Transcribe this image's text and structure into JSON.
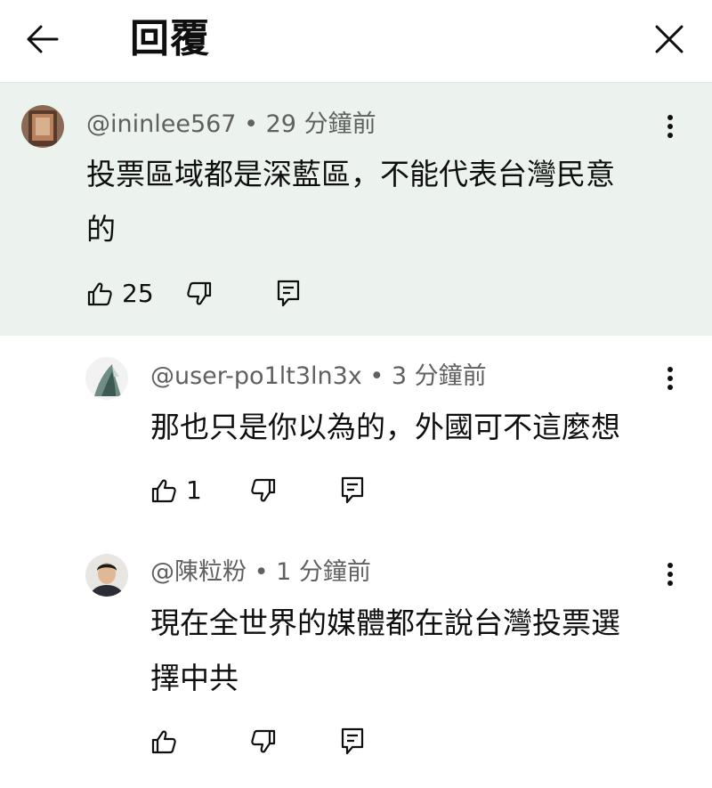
{
  "header": {
    "title": "回覆",
    "back_icon": "arrow-left-icon",
    "close_icon": "close-icon"
  },
  "comments": [
    {
      "author": "@ininlee567",
      "separator": "•",
      "time": "29 分鐘前",
      "text_line1": "投票區域都是深藍區，不能代表台灣民意",
      "text_line2": "的",
      "likes": "25",
      "highlighted": true
    },
    {
      "author": "@user-po1lt3ln3x",
      "separator": "•",
      "time": "3 分鐘前",
      "text_line1": "那也只是你以為的，外國可不這麼想",
      "likes": "1"
    },
    {
      "author": "@陳粒粉",
      "separator": "•",
      "time": "1 分鐘前",
      "text_line1": "現在全世界的媒體都在說台灣投票選",
      "text_line2": "擇中共",
      "likes": ""
    }
  ],
  "colors": {
    "highlight_bg": "#ecf3ee",
    "meta_text": "#606060",
    "text": "#0f0f0f"
  }
}
